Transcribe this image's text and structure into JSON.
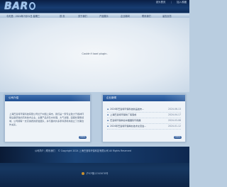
{
  "header": {
    "logo_text": "BAR",
    "logo_letter_o": "O",
    "top_links": [
      "设为首页",
      "加入收藏"
    ]
  },
  "nav": {
    "welcome": "今天是：2024年7月31日 星期三",
    "items": [
      "首 页",
      "关于我们",
      "产品展示",
      "企业新闻",
      "联系我们",
      "留言反馈"
    ]
  },
  "banner": {
    "message": "Couldn't load plugin."
  },
  "about": {
    "title": "公司介绍",
    "text": "上海巴洛特环保科技有限公司位于中国上海市，我们是一家专业致力于各种环保设备研发的高新技术企业。主要产品涉及水处理、大气治理、固废处理等领域，公司拥有一支高素质的研发团队，并与国内外多家科研机构建立了长期合作关系。",
    "more_label": "more"
  },
  "news": {
    "title": "企业新闻",
    "items": [
      {
        "title": "2024年巴洛特环保科技新品发布...",
        "date": "2024-06-13"
      },
      {
        "title": "上海巴洛特环保新厂房落成",
        "date": "2024-04-17"
      },
      {
        "title": "巴洛特环保参加中国国际环保展",
        "date": "2024-03-08"
      },
      {
        "title": "2024年巴洛特环保举办技术交流会...",
        "date": "2024-01-12"
      }
    ],
    "more_label": "more"
  },
  "footer": {
    "links": "公司简介 | 联系我们",
    "copyright": "© Copyright 2024  上海巴洛特环保科技有限公司 All Rights Reserved",
    "icp": "沪ICP备12345678号"
  }
}
